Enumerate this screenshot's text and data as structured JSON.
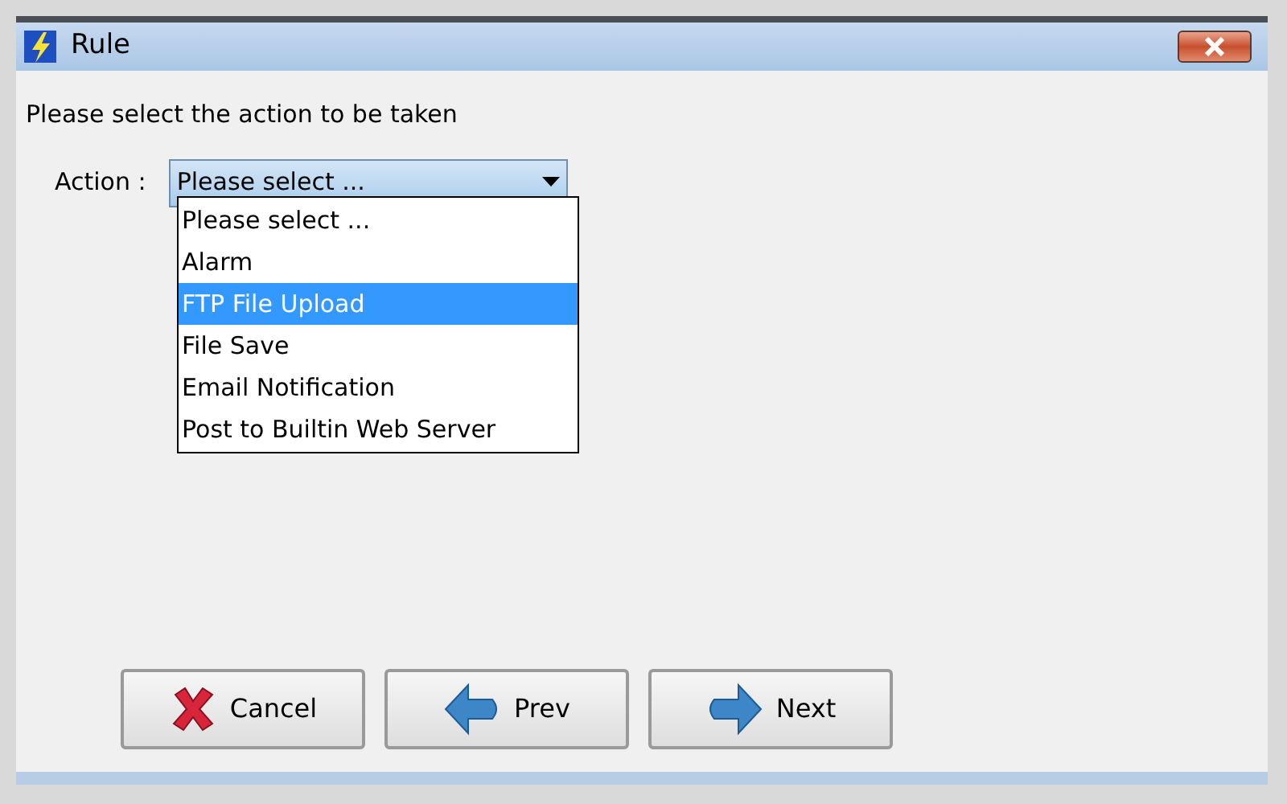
{
  "window": {
    "title": "Rule"
  },
  "prompt": "Please select the action to be taken",
  "action": {
    "label": "Action :",
    "value": "Please select ...",
    "expanded": true,
    "options": [
      {
        "label": "Please select ...",
        "highlighted": false
      },
      {
        "label": "Alarm",
        "highlighted": false
      },
      {
        "label": "FTP File Upload",
        "highlighted": true
      },
      {
        "label": "File Save",
        "highlighted": false
      },
      {
        "label": "Email Notification",
        "highlighted": false
      },
      {
        "label": "Post to Builtin Web Server",
        "highlighted": false
      }
    ]
  },
  "buttons": [
    {
      "kind": "cancel",
      "label": "Cancel"
    },
    {
      "kind": "prev",
      "label": "Prev"
    },
    {
      "kind": "next",
      "label": "Next"
    }
  ]
}
